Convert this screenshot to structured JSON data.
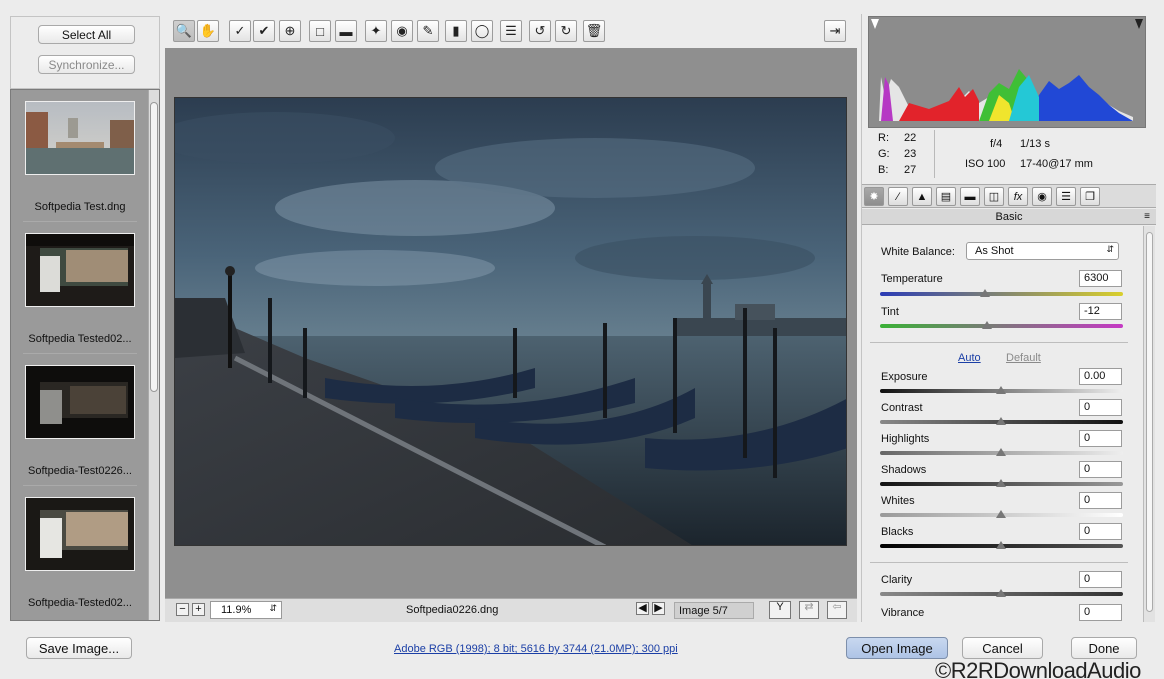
{
  "left_panel": {
    "select_all": "Select All",
    "synchronize": "Synchronize...",
    "thumbnails": [
      {
        "name": "Softpedia Test.dng"
      },
      {
        "name": "Softpedia Tested02..."
      },
      {
        "name": "Softpedia-Test0226..."
      },
      {
        "name": "Softpedia-Tested02..."
      }
    ]
  },
  "toolbar": {
    "tools": [
      "zoom-icon",
      "hand-icon",
      "white-balance-icon",
      "color-sampler-icon",
      "targeted-adjust-icon",
      "crop-icon",
      "straighten-icon",
      "spot-removal-icon",
      "red-eye-icon",
      "adjustment-brush-icon",
      "graduated-filter-icon",
      "radial-filter-icon",
      "list-icon",
      "rotate-ccw-icon",
      "rotate-cw-icon",
      "trash-icon"
    ],
    "fullscreen_icon": "fullscreen-icon"
  },
  "preview": {
    "zoom": "11.9%",
    "filename": "Softpedia0226.dng",
    "image_counter": "Image 5/7"
  },
  "histogram": {
    "r_label": "R:",
    "r": "22",
    "g_label": "G:",
    "g": "23",
    "b_label": "B:",
    "b": "27",
    "aperture": "f/4",
    "shutter": "1/13 s",
    "iso": "ISO 100",
    "lens": "17-40@17 mm"
  },
  "panel": {
    "section_title": "Basic",
    "white_balance_label": "White Balance:",
    "white_balance_value": "As Shot",
    "temperature_label": "Temperature",
    "temperature": "6300",
    "tint_label": "Tint",
    "tint": "-12",
    "auto": "Auto",
    "default": "Default",
    "sliders": [
      {
        "label": "Exposure",
        "value": "0.00"
      },
      {
        "label": "Contrast",
        "value": "0"
      },
      {
        "label": "Highlights",
        "value": "0"
      },
      {
        "label": "Shadows",
        "value": "0"
      },
      {
        "label": "Whites",
        "value": "0"
      },
      {
        "label": "Blacks",
        "value": "0"
      }
    ],
    "clarity_label": "Clarity",
    "clarity": "0",
    "vibrance_label": "Vibrance",
    "vibrance": "0"
  },
  "bottom": {
    "save_image": "Save Image...",
    "info": "Adobe RGB (1998); 8 bit; 5616 by 3744 (21.0MP); 300 ppi",
    "open_image": "Open Image",
    "cancel": "Cancel",
    "done": "Done",
    "watermark": "©R2RDownloadAudio"
  },
  "colors": {
    "accent": "#1b3fa6",
    "preview_bg": "#8f8f8f"
  }
}
